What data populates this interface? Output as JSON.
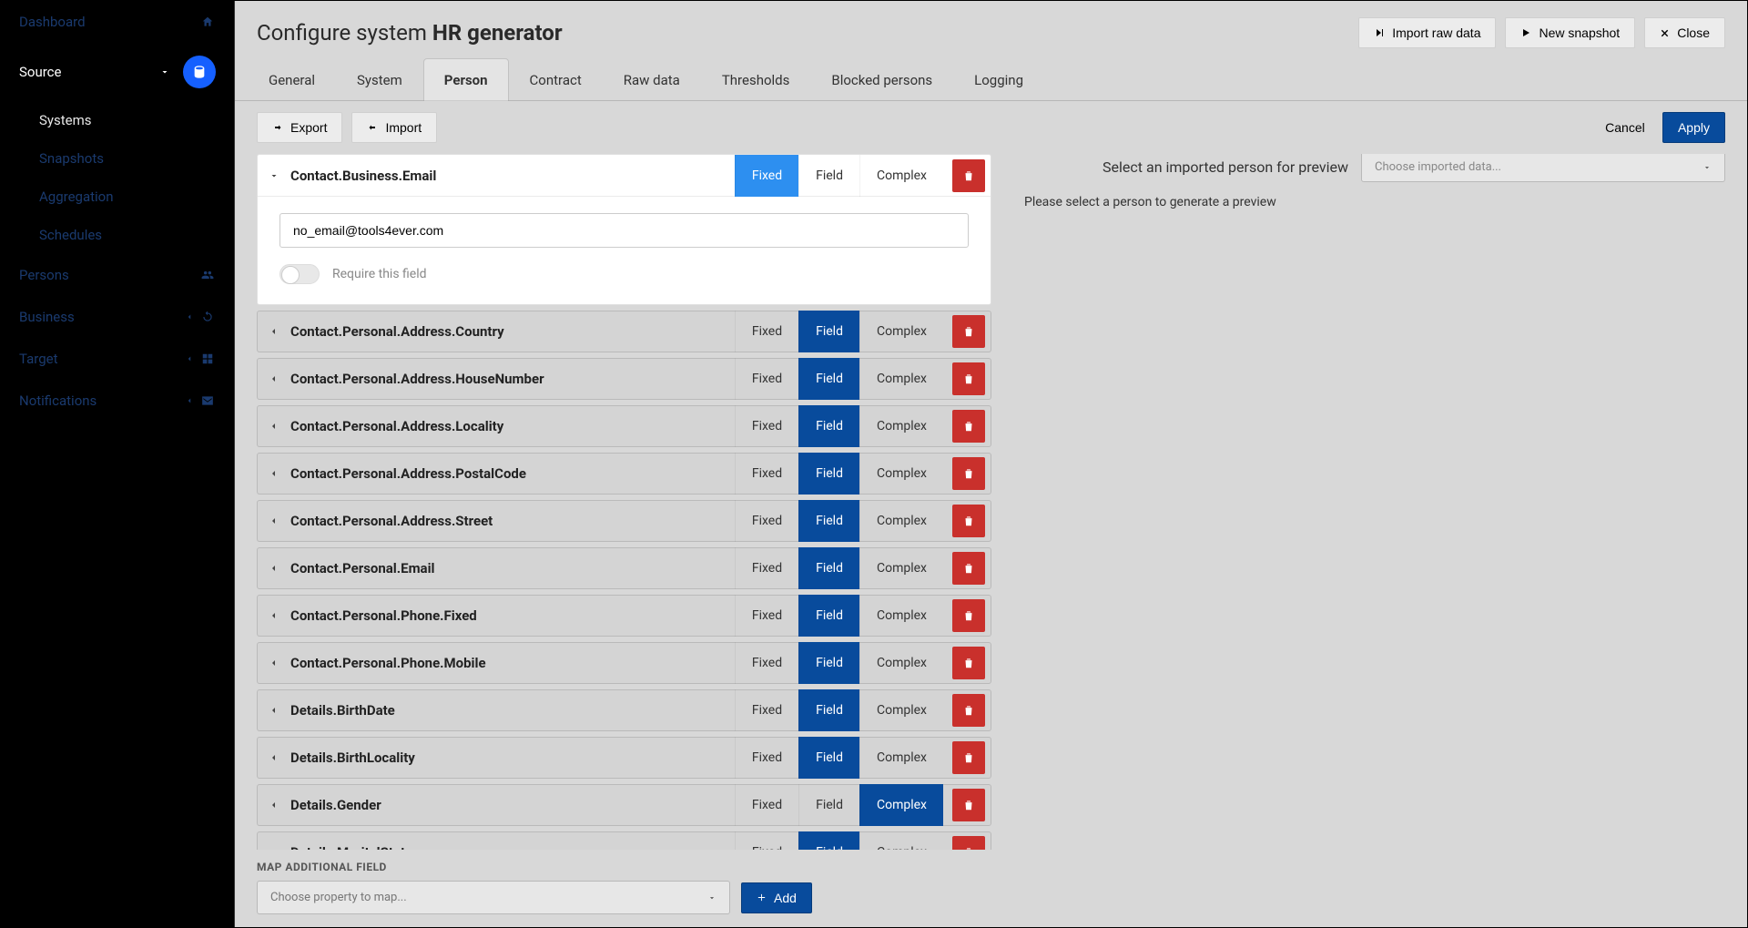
{
  "sidebar": {
    "dashboard": "Dashboard",
    "source": "Source",
    "sub": {
      "systems": "Systems",
      "snapshots": "Snapshots",
      "aggregation": "Aggregation",
      "schedules": "Schedules"
    },
    "persons": "Persons",
    "business": "Business",
    "target": "Target",
    "notifications": "Notifications"
  },
  "header": {
    "title_prefix": "Configure system ",
    "title_bold": "HR generator",
    "import_raw": "Import raw data",
    "new_snapshot": "New snapshot",
    "close": "Close"
  },
  "tabs": [
    "General",
    "System",
    "Person",
    "Contract",
    "Raw data",
    "Thresholds",
    "Blocked persons",
    "Logging"
  ],
  "active_tab": "Person",
  "toolbar": {
    "export": "Export",
    "import": "Import",
    "cancel": "Cancel",
    "apply": "Apply"
  },
  "type_labels": {
    "fixed": "Fixed",
    "field": "Field",
    "complex": "Complex"
  },
  "expanded": {
    "name": "Contact.Business.Email",
    "value": "no_email@tools4ever.com",
    "require_label": "Require this field",
    "active_type": "fixed"
  },
  "fields": [
    {
      "name": "Contact.Personal.Address.Country",
      "active": "field"
    },
    {
      "name": "Contact.Personal.Address.HouseNumber",
      "active": "field"
    },
    {
      "name": "Contact.Personal.Address.Locality",
      "active": "field"
    },
    {
      "name": "Contact.Personal.Address.PostalCode",
      "active": "field"
    },
    {
      "name": "Contact.Personal.Address.Street",
      "active": "field"
    },
    {
      "name": "Contact.Personal.Email",
      "active": "field"
    },
    {
      "name": "Contact.Personal.Phone.Fixed",
      "active": "field"
    },
    {
      "name": "Contact.Personal.Phone.Mobile",
      "active": "field"
    },
    {
      "name": "Details.BirthDate",
      "active": "field"
    },
    {
      "name": "Details.BirthLocality",
      "active": "field"
    },
    {
      "name": "Details.Gender",
      "active": "complex"
    },
    {
      "name": "Details.MaritalStatus",
      "active": "field"
    }
  ],
  "map_footer": {
    "label": "MAP ADDITIONAL FIELD",
    "placeholder": "Choose property to map...",
    "add": "Add"
  },
  "preview": {
    "header": "Select an imported person for preview",
    "placeholder": "Choose imported data...",
    "message": "Please select a person to generate a preview"
  }
}
